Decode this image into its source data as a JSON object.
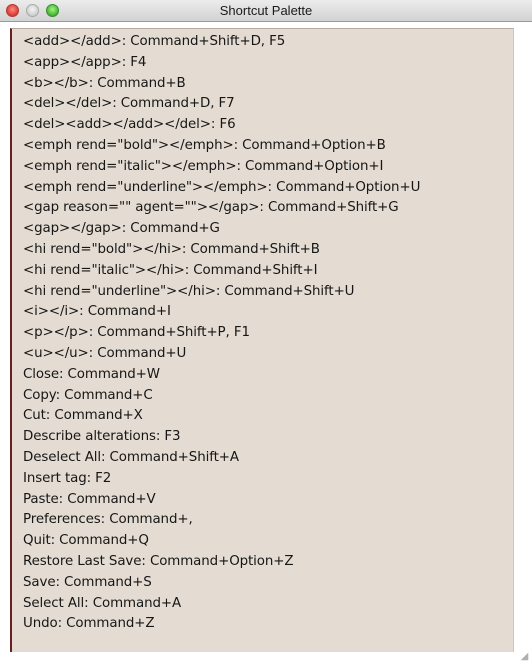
{
  "window": {
    "title": "Shortcut Palette"
  },
  "shortcuts": [
    "<add></add>: Command+Shift+D, F5",
    "<app></app>: F4",
    "<b></b>: Command+B",
    "<del></del>: Command+D, F7",
    "<del><add></add></del>: F6",
    "<emph rend=\"bold\"></emph>: Command+Option+B",
    "<emph rend=\"italic\"></emph>: Command+Option+I",
    "<emph rend=\"underline\"></emph>: Command+Option+U",
    "<gap reason=\"\" agent=\"\"></gap>: Command+Shift+G",
    "<gap></gap>: Command+G",
    "<hi rend=\"bold\"></hi>: Command+Shift+B",
    "<hi rend=\"italic\"></hi>: Command+Shift+I",
    "<hi rend=\"underline\"></hi>: Command+Shift+U",
    "<i></i>: Command+I",
    "<p></p>: Command+Shift+P, F1",
    "<u></u>: Command+U",
    "Close: Command+W",
    "Copy: Command+C",
    "Cut: Command+X",
    "Describe alterations: F3",
    "Deselect All: Command+Shift+A",
    "Insert tag: F2",
    "Paste: Command+V",
    "Preferences: Command+,",
    "Quit: Command+Q",
    "Restore Last Save: Command+Option+Z",
    "Save: Command+S",
    "Select All: Command+A",
    "Undo: Command+Z"
  ]
}
